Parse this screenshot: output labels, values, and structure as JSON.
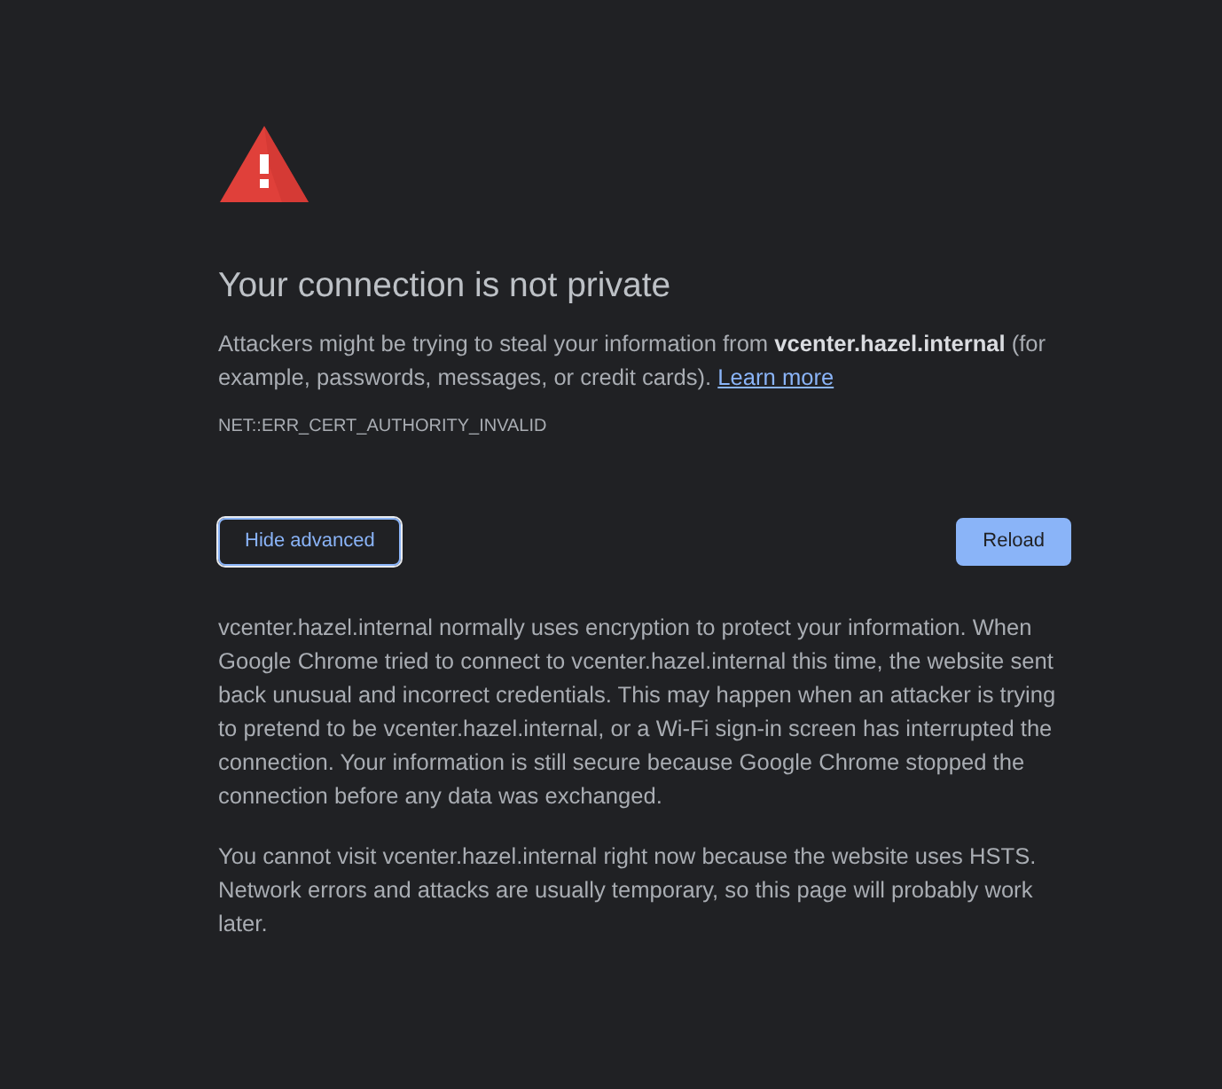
{
  "heading": "Your connection is not private",
  "intro": {
    "text": "Attackers might be trying to steal your information from **vcenter.hazel.internal** (for example, passwords, messages, or credit cards).",
    "link": "Learn more"
  },
  "error_code": "NET::ERR_CERT_AUTHORITY_INVALID",
  "buttons": [
    {
      "kind": "secondary",
      "label": "Hide advanced",
      "focused": true
    },
    {
      "kind": "primary",
      "label": "Reload",
      "focused": false
    }
  ],
  "details": [
    "vcenter.hazel.internal normally uses encryption to protect your information. When Google Chrome tried to connect to vcenter.hazel.internal this time, the website sent back unusual and incorrect credentials. This may happen when an attacker is trying to pretend to be vcenter.hazel.internal, or a Wi-Fi sign-in screen has interrupted the connection. Your information is still secure because Google Chrome stopped the connection before any data was exchanged.",
    "You cannot visit vcenter.hazel.internal right now because the website uses HSTS. Network errors and attacks are usually temporary, so this page will probably work later."
  ]
}
